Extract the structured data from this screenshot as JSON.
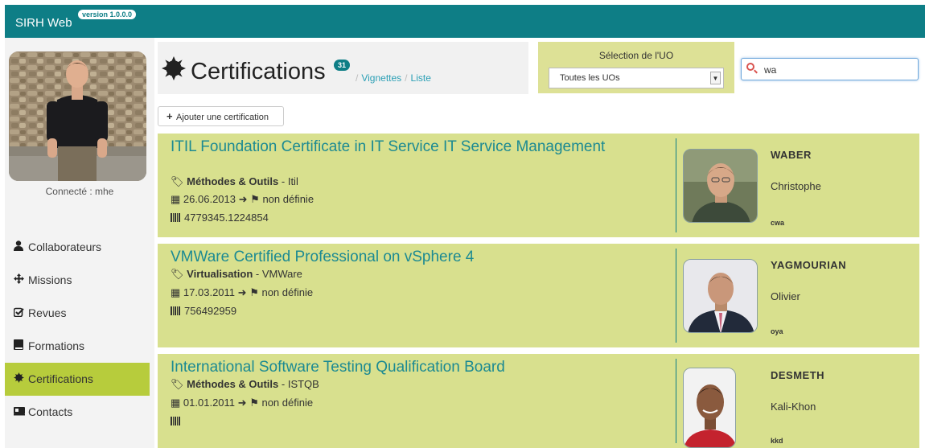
{
  "app": {
    "name": "SIRH Web",
    "version": "version 1.0.0.0"
  },
  "user": {
    "connected_text": "Connecté : mhe"
  },
  "nav": [
    {
      "label": "Collaborateurs",
      "icon": "user-icon"
    },
    {
      "label": "Missions",
      "icon": "move-icon"
    },
    {
      "label": "Revues",
      "icon": "check-icon"
    },
    {
      "label": "Formations",
      "icon": "book-icon"
    },
    {
      "label": "Certifications",
      "icon": "certificate-icon",
      "active": true
    },
    {
      "label": "Contacts",
      "icon": "card-icon"
    }
  ],
  "header": {
    "title": "Certifications",
    "count": "31",
    "link_vignettes": "Vignettes",
    "link_liste": "Liste"
  },
  "uo": {
    "label": "Sélection de l'UO",
    "selected": "Toutes les UOs"
  },
  "search": {
    "value": "wa"
  },
  "add_button": "Ajouter une certification",
  "certifications": [
    {
      "title": "ITIL Foundation Certificate in IT Service IT Service Management",
      "category": "Méthodes & Outils",
      "sub": "Itil",
      "date": "26.06.2013",
      "end": "non définie",
      "number": "4779345.1224854",
      "lastname": "WABER",
      "firstname": "Christophe",
      "initials": "cwa"
    },
    {
      "title": "VMWare Certified Professional on vSphere 4",
      "category": "Virtualisation",
      "sub": "VMWare",
      "date": "17.03.2011",
      "end": "non définie",
      "number": "756492959",
      "lastname": "YAGMOURIAN",
      "firstname": "Olivier",
      "initials": "oya"
    },
    {
      "title": "International Software Testing Qualification Board",
      "category": "Méthodes & Outils",
      "sub": "ISTQB",
      "date": "01.01.2011",
      "end": "non définie",
      "number": "",
      "lastname": "DESMETH",
      "firstname": "Kali-Khon",
      "initials": "kkd"
    }
  ],
  "colors": {
    "teal": "#0e7e86",
    "card_bg": "#d8e08e",
    "active_nav": "#b7cc3c",
    "link": "#2a9fb5"
  }
}
